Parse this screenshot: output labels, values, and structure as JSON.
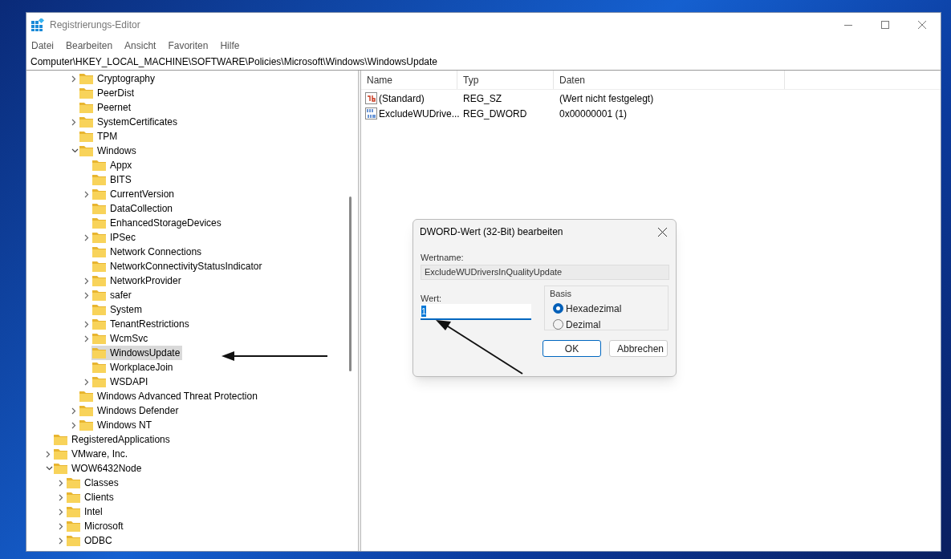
{
  "window": {
    "title": "Registrierungs-Editor"
  },
  "menu": [
    "Datei",
    "Bearbeiten",
    "Ansicht",
    "Favoriten",
    "Hilfe"
  ],
  "address": "Computer\\HKEY_LOCAL_MACHINE\\SOFTWARE\\Policies\\Microsoft\\Windows\\WindowsUpdate",
  "tree": {
    "items": [
      {
        "children": [
          {
            "children": [
              {
                "children": [
                  {
                    "label": "Cryptography",
                    "kind": "branch",
                    "expanded": false,
                    "selected": false
                  },
                  {
                    "label": "PeerDist",
                    "kind": "leaf",
                    "selected": false
                  },
                  {
                    "label": "Peernet",
                    "kind": "leaf",
                    "selected": false
                  },
                  {
                    "label": "SystemCertificates",
                    "kind": "branch",
                    "expanded": false,
                    "selected": false
                  },
                  {
                    "label": "TPM",
                    "kind": "leaf",
                    "selected": false
                  },
                  {
                    "label": "Windows",
                    "kind": "branch",
                    "expanded": true,
                    "selected": false,
                    "children": [
                      {
                        "label": "Appx",
                        "kind": "leaf",
                        "selected": false
                      },
                      {
                        "label": "BITS",
                        "kind": "leaf",
                        "selected": false
                      },
                      {
                        "label": "CurrentVersion",
                        "kind": "branch",
                        "expanded": false,
                        "selected": false
                      },
                      {
                        "label": "DataCollection",
                        "kind": "leaf",
                        "selected": false
                      },
                      {
                        "label": "EnhancedStorageDevices",
                        "kind": "leaf",
                        "selected": false
                      },
                      {
                        "label": "IPSec",
                        "kind": "branch",
                        "expanded": false,
                        "selected": false
                      },
                      {
                        "label": "Network Connections",
                        "kind": "leaf",
                        "selected": false
                      },
                      {
                        "label": "NetworkConnectivityStatusIndicator",
                        "kind": "leaf",
                        "selected": false
                      },
                      {
                        "label": "NetworkProvider",
                        "kind": "branch",
                        "expanded": false,
                        "selected": false
                      },
                      {
                        "label": "safer",
                        "kind": "branch",
                        "expanded": false,
                        "selected": false
                      },
                      {
                        "label": "System",
                        "kind": "leaf",
                        "selected": false
                      },
                      {
                        "label": "TenantRestrictions",
                        "kind": "branch",
                        "expanded": false,
                        "selected": false
                      },
                      {
                        "label": "WcmSvc",
                        "kind": "branch",
                        "expanded": false,
                        "selected": false
                      },
                      {
                        "label": "WindowsUpdate",
                        "kind": "leaf",
                        "selected": true
                      },
                      {
                        "label": "WorkplaceJoin",
                        "kind": "leaf",
                        "selected": false
                      },
                      {
                        "label": "WSDAPI",
                        "kind": "branch",
                        "expanded": false,
                        "selected": false
                      }
                    ]
                  },
                  {
                    "label": "Windows Advanced Threat Protection",
                    "kind": "leaf",
                    "selected": false
                  },
                  {
                    "label": "Windows Defender",
                    "kind": "branch",
                    "expanded": false,
                    "selected": false
                  },
                  {
                    "label": "Windows NT",
                    "kind": "branch",
                    "expanded": false,
                    "selected": false
                  }
                ]
              }
            ]
          },
          {
            "label": "RegisteredApplications",
            "kind": "leaf",
            "selected": false
          },
          {
            "label": "VMware, Inc.",
            "kind": "branch",
            "expanded": false,
            "selected": false
          },
          {
            "label": "WOW6432Node",
            "kind": "branch",
            "expanded": true,
            "selected": false,
            "children": [
              {
                "label": "Classes",
                "kind": "branch",
                "expanded": false,
                "selected": false
              },
              {
                "label": "Clients",
                "kind": "branch",
                "expanded": false,
                "selected": false
              },
              {
                "label": "Intel",
                "kind": "branch",
                "expanded": false,
                "selected": false
              },
              {
                "label": "Microsoft",
                "kind": "branch",
                "expanded": false,
                "selected": false
              },
              {
                "label": "ODBC",
                "kind": "branch",
                "expanded": false,
                "selected": false
              }
            ]
          }
        ]
      }
    ]
  },
  "values": {
    "columns": [
      "Name",
      "Typ",
      "Daten"
    ],
    "rows": [
      {
        "kind": "string",
        "name": "(Standard)",
        "type": "REG_SZ",
        "data": "(Wert nicht festgelegt)"
      },
      {
        "kind": "binary",
        "name": "ExcludeWUDrive...",
        "type": "REG_DWORD",
        "data": "0x00000001 (1)"
      }
    ]
  },
  "dialog": {
    "title": "DWORD-Wert (32-Bit) bearbeiten",
    "name_label": "Wertname:",
    "name_value": "ExcludeWUDriversInQualityUpdate",
    "value_label": "Wert:",
    "value": "1",
    "basis_label": "Basis",
    "radios": [
      {
        "label": "Hexadezimal",
        "selected": true
      },
      {
        "label": "Dezimal",
        "selected": false
      }
    ],
    "buttons": [
      {
        "label": "OK",
        "default": true
      },
      {
        "label": "Abbrechen",
        "default": false
      }
    ]
  }
}
